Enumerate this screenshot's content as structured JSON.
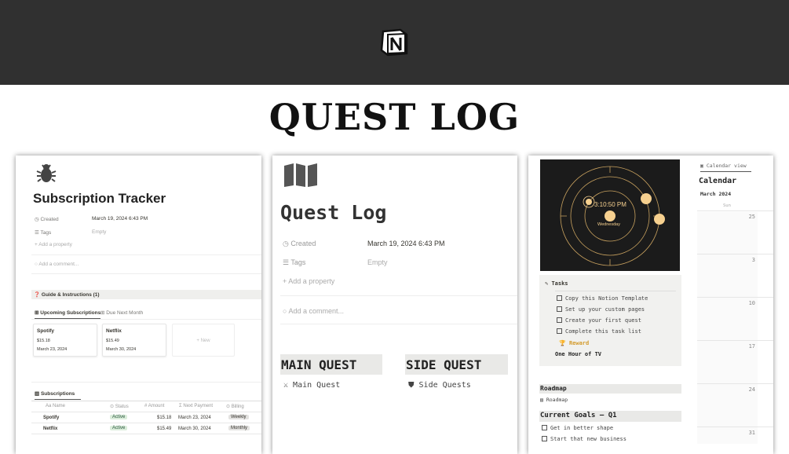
{
  "header": {
    "logo": "notion-logo",
    "title": "QUEST LOG"
  },
  "card1": {
    "icon": "bug-icon",
    "title": "Subscription Tracker",
    "properties": [
      {
        "label": "Created",
        "value": "March 19, 2024 6:43 PM"
      },
      {
        "label": "Tags",
        "value": "Empty"
      }
    ],
    "add_property": "Add a property",
    "add_comment": "Add a comment...",
    "guide": "Guide & Instructions (1)",
    "tabs": [
      "Upcoming Subscriptions",
      "Due Next Month"
    ],
    "gallery": [
      {
        "name": "Spotify",
        "amount": "$15.18",
        "date": "March 23, 2024"
      },
      {
        "name": "Netflix",
        "amount": "$15.49",
        "date": "March 30, 2024"
      }
    ],
    "new_label": "+ New",
    "table_tab": "Subscriptions",
    "columns": [
      "Aa Name",
      "Status",
      "Amount",
      "Next Payment",
      "Billing"
    ],
    "rows": [
      {
        "name": "Spotify",
        "status": "Active",
        "amount": "$15.18",
        "next": "March 23, 2024",
        "billing": "Weekly"
      },
      {
        "name": "Netflix",
        "status": "Active",
        "amount": "$15.49",
        "next": "March 30, 2024",
        "billing": "Monthly"
      }
    ]
  },
  "card2": {
    "icon": "map-icon",
    "title": "Quest Log",
    "properties": [
      {
        "label": "Created",
        "value": "March 19, 2024 6:43 PM"
      },
      {
        "label": "Tags",
        "value": "Empty"
      }
    ],
    "add_property": "Add a property",
    "add_comment": "Add a comment...",
    "main_quest_header": "MAIN QUEST",
    "main_quest_link": "Main Quest",
    "side_quest_header": "SIDE QUEST",
    "side_quest_link": "Side Quests"
  },
  "card3": {
    "clock": {
      "time": "3:10:50 PM",
      "day": "Wednesday",
      "accent": "#f6d08f"
    },
    "tasks_title": "Tasks",
    "tasks": [
      "Copy this Notion Template",
      "Set up your custom pages",
      "Create your first quest",
      "Complete this task list"
    ],
    "reward_label": "Reward",
    "reward_value": "One Hour of TV",
    "roadmap_header": "Roadmap",
    "roadmap_link": "Roadmap",
    "goals_header": "Current Goals — Q1",
    "goals": [
      "Get in better shape",
      "Start that new business"
    ],
    "calendar": {
      "view": "Calendar view",
      "title": "Calendar",
      "month": "March 2024",
      "weekday": "Sun",
      "dates": [
        "25",
        "3",
        "10",
        "17",
        "24",
        "31"
      ]
    }
  }
}
